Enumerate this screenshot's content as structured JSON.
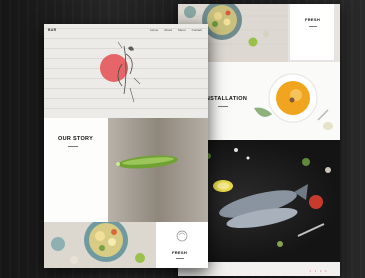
{
  "front_page": {
    "brand": "BAR",
    "nav": [
      "Home",
      "About",
      "Menu",
      "Contact"
    ],
    "story_heading": "OUR STORY",
    "card_heading": "FRESH"
  },
  "back_page": {
    "top_card_heading": "FRESH",
    "mid_heading": "INSTALLATION",
    "footer_dots": "• • • •"
  },
  "colors": {
    "background": "#1b1b1b",
    "accent_red": "#e5575a",
    "soup": "#f1a51f",
    "fish": "#8a94a0"
  }
}
